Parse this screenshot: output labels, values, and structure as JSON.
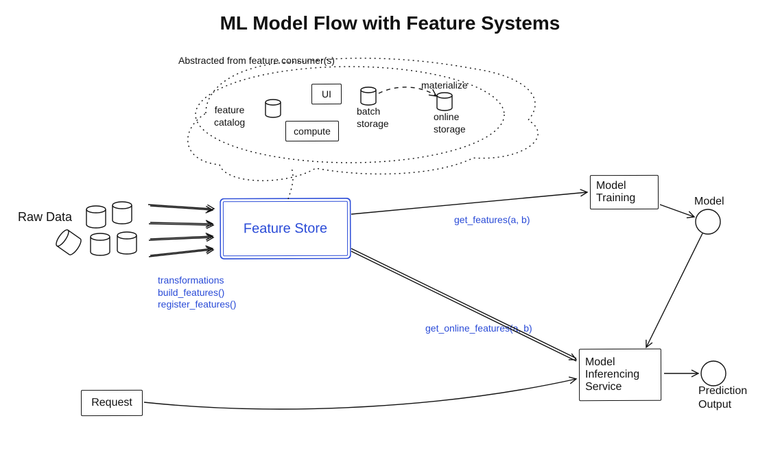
{
  "title": "ML Model Flow with Feature Systems",
  "annotations": {
    "abstracted": "Abstracted from feature consumer(s)",
    "transformations": "transformations\nbuild_features()\nregister_features()",
    "get_features": "get_features(a, b)",
    "get_online_features": "get_online_features(a, b)",
    "materialize": "materialize"
  },
  "boxes": {
    "feature_store": "Feature Store",
    "model_training": "Model\nTraining",
    "model_inferencing": "Model\nInferencing\nService",
    "request": "Request",
    "ui": "UI",
    "compute": "compute"
  },
  "labels": {
    "raw_data": "Raw Data",
    "model": "Model",
    "prediction_output": "Prediction\nOutput",
    "feature_catalog": "feature\ncatalog",
    "batch_storage": "batch\nstorage",
    "online_storage": "online\nstorage"
  },
  "colors": {
    "ink": "#111111",
    "accent": "#2a4bd7",
    "bg": "#ffffff"
  }
}
